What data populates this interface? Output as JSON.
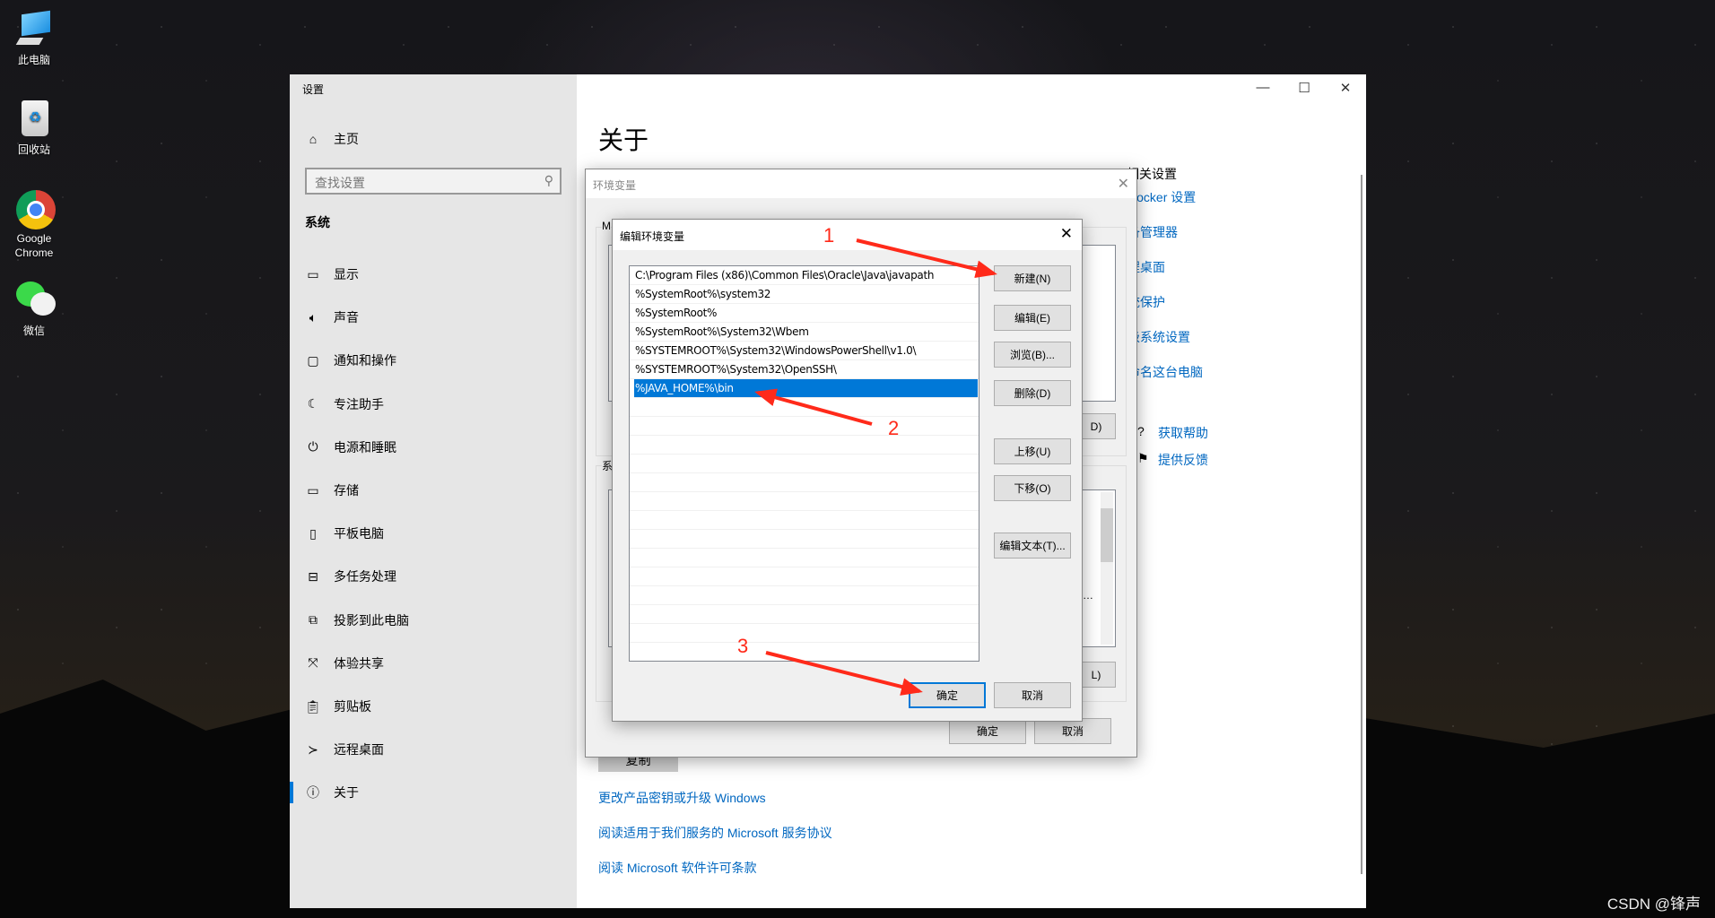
{
  "desktop": {
    "icons": [
      {
        "label": "此电脑",
        "icon": "computer-icon"
      },
      {
        "label": "回收站",
        "icon": "recycle-bin-icon"
      },
      {
        "label": "Google Chrome",
        "icon": "chrome-icon"
      },
      {
        "label": "微信",
        "icon": "wechat-icon"
      }
    ]
  },
  "settings": {
    "title": "设置",
    "home": "主页",
    "search_placeholder": "查找设置",
    "section": "系统",
    "nav": [
      {
        "label": "显示",
        "icon": "display-icon"
      },
      {
        "label": "声音",
        "icon": "sound-icon"
      },
      {
        "label": "通知和操作",
        "icon": "notification-icon"
      },
      {
        "label": "专注助手",
        "icon": "moon-icon"
      },
      {
        "label": "电源和睡眠",
        "icon": "power-icon"
      },
      {
        "label": "存储",
        "icon": "storage-icon"
      },
      {
        "label": "平板电脑",
        "icon": "tablet-icon"
      },
      {
        "label": "多任务处理",
        "icon": "multitask-icon"
      },
      {
        "label": "投影到此电脑",
        "icon": "project-icon"
      },
      {
        "label": "体验共享",
        "icon": "share-icon"
      },
      {
        "label": "剪贴板",
        "icon": "clipboard-icon"
      },
      {
        "label": "远程桌面",
        "icon": "remote-desktop-icon"
      },
      {
        "label": "关于",
        "icon": "info-icon",
        "selected": true
      }
    ],
    "page_title": "关于",
    "related_title": "相关设置",
    "related_links": [
      "BitLocker 设置",
      "设备管理器",
      "远程桌面",
      "系统保护",
      "高级系统设置",
      "重命名这台电脑"
    ],
    "help": "获取帮助",
    "feedback": "提供反馈",
    "copy_button": "复制",
    "bottom_links": [
      "更改产品密钥或升级 Windows",
      "阅读适用于我们服务的 Microsoft 服务协议",
      "阅读 Microsoft 软件许可条款"
    ]
  },
  "env_dialog": {
    "title": "环境变量",
    "group1_label": "M",
    "group2_label": "系",
    "btn1_tail": "D)",
    "btn2_tail": "L)",
    "btn3_tail": "…",
    "ok": "确定",
    "cancel": "取消"
  },
  "edit_dialog": {
    "title": "编辑环境变量",
    "entries": [
      "C:\\Program Files (x86)\\Common Files\\Oracle\\Java\\javapath",
      "%SystemRoot%\\system32",
      "%SystemRoot%",
      "%SystemRoot%\\System32\\Wbem",
      "%SYSTEMROOT%\\System32\\WindowsPowerShell\\v1.0\\",
      "%SYSTEMROOT%\\System32\\OpenSSH\\",
      "%JAVA_HOME%\\bin"
    ],
    "selected_index": 6,
    "buttons": {
      "new": "新建(N)",
      "edit": "编辑(E)",
      "browse": "浏览(B)...",
      "delete": "删除(D)",
      "up": "上移(U)",
      "down": "下移(O)",
      "edit_text": "编辑文本(T)...",
      "ok": "确定",
      "cancel": "取消"
    }
  },
  "annotations": {
    "step1": "1",
    "step2": "2",
    "step3": "3",
    "color": "#ff2a1a"
  },
  "watermark": "CSDN @锋声"
}
